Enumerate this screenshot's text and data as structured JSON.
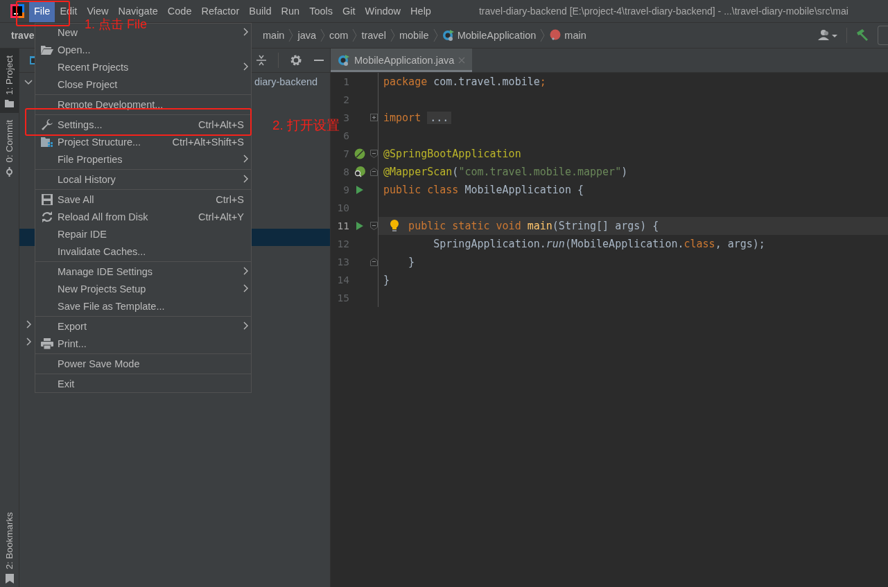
{
  "menu_bar": {
    "items": [
      {
        "label": "File",
        "selected": true
      },
      {
        "label": "Edit",
        "selected": false
      },
      {
        "label": "View",
        "selected": false
      },
      {
        "label": "Navigate",
        "selected": false
      },
      {
        "label": "Code",
        "selected": false
      },
      {
        "label": "Refactor",
        "selected": false
      },
      {
        "label": "Build",
        "selected": false
      },
      {
        "label": "Run",
        "selected": false
      },
      {
        "label": "Tools",
        "selected": false
      },
      {
        "label": "Git",
        "selected": false
      },
      {
        "label": "Window",
        "selected": false
      },
      {
        "label": "Help",
        "selected": false
      }
    ],
    "window_title": "travel-diary-backend [E:\\project-4\\travel-diary-backend] - ...\\travel-diary-mobile\\src\\mai"
  },
  "navigation_bar": {
    "project": "trave",
    "breadcrumbs": [
      {
        "label": "main",
        "kind": "folder"
      },
      {
        "label": "java",
        "kind": "folder"
      },
      {
        "label": "com",
        "kind": "folder"
      },
      {
        "label": "travel",
        "kind": "folder"
      },
      {
        "label": "mobile",
        "kind": "folder"
      },
      {
        "label": "MobileApplication",
        "kind": "class"
      },
      {
        "label": "main",
        "kind": "method"
      }
    ]
  },
  "tool_stripe": [
    {
      "label": "1: Project",
      "selected": true
    },
    {
      "label": "0: Commit",
      "selected": false
    }
  ],
  "bottom_stripe": [
    {
      "label": "2: Bookmarks",
      "selected": false
    }
  ],
  "project_panel": {
    "tree": [
      {
        "label": "diary-backend",
        "expanded": true,
        "selected": false
      },
      {
        "selected": true
      },
      {
        "expanded": false,
        "selected": false
      },
      {
        "expanded": false,
        "selected": false
      }
    ]
  },
  "file_menu": [
    {
      "kind": "item",
      "label": "New",
      "submenu": true
    },
    {
      "kind": "item",
      "label": "Open...",
      "submenu": false
    },
    {
      "kind": "item",
      "label": "Recent Projects",
      "submenu": true
    },
    {
      "kind": "item",
      "label": "Close Project",
      "submenu": false
    },
    {
      "kind": "separator"
    },
    {
      "kind": "item",
      "label": "Remote Development...",
      "submenu": false
    },
    {
      "kind": "separator"
    },
    {
      "kind": "item",
      "label": "Settings...",
      "shortcut": "Ctrl+Alt+S",
      "submenu": false
    },
    {
      "kind": "item",
      "label": "Project Structure...",
      "shortcut": "Ctrl+Alt+Shift+S",
      "submenu": false
    },
    {
      "kind": "item",
      "label": "File Properties",
      "submenu": true
    },
    {
      "kind": "separator"
    },
    {
      "kind": "item",
      "label": "Local History",
      "submenu": true
    },
    {
      "kind": "separator"
    },
    {
      "kind": "item",
      "label": "Save All",
      "shortcut": "Ctrl+S",
      "submenu": false
    },
    {
      "kind": "item",
      "label": "Reload All from Disk",
      "shortcut": "Ctrl+Alt+Y",
      "submenu": false
    },
    {
      "kind": "item",
      "label": "Repair IDE",
      "submenu": false
    },
    {
      "kind": "item",
      "label": "Invalidate Caches...",
      "submenu": false
    },
    {
      "kind": "separator"
    },
    {
      "kind": "item",
      "label": "Manage IDE Settings",
      "submenu": true
    },
    {
      "kind": "item",
      "label": "New Projects Setup",
      "submenu": true
    },
    {
      "kind": "item",
      "label": "Save File as Template...",
      "submenu": false
    },
    {
      "kind": "separator"
    },
    {
      "kind": "item",
      "label": "Export",
      "submenu": true
    },
    {
      "kind": "item",
      "label": "Print...",
      "submenu": false
    },
    {
      "kind": "separator"
    },
    {
      "kind": "item",
      "label": "Power Save Mode",
      "submenu": false
    },
    {
      "kind": "separator"
    },
    {
      "kind": "item",
      "label": "Exit",
      "submenu": false
    }
  ],
  "editor": {
    "tabs": [
      {
        "label": "MobileApplication.java",
        "selected": true
      }
    ],
    "lines": [
      {
        "number": "1",
        "tokens": [
          {
            "text": "package",
            "kind": "keyword"
          },
          {
            "text": " com.travel.mobile",
            "kind": "plain"
          },
          {
            "text": ";",
            "kind": "keyword"
          }
        ]
      },
      {
        "number": "2"
      },
      {
        "number": "3",
        "fold": {
          "kind": "collapsed"
        },
        "tokens": [
          {
            "text": "import ",
            "kind": "keyword"
          },
          {
            "text": "...",
            "kind": "folded"
          }
        ]
      },
      {
        "number": "6"
      },
      {
        "number": "7",
        "gutter": {
          "kind": "spring"
        },
        "fold": {
          "kind": "open"
        },
        "tokens": [
          {
            "text": "@SpringBootApplication",
            "kind": "annotation"
          }
        ]
      },
      {
        "number": "8",
        "gutter": {
          "kind": "spring-search"
        },
        "fold": {
          "kind": "close"
        },
        "tokens": [
          {
            "text": "@MapperScan",
            "kind": "annotation"
          },
          {
            "text": "(",
            "kind": "plain"
          },
          {
            "text": "\"com.travel.mobile.mapper\"",
            "kind": "string"
          },
          {
            "text": ")",
            "kind": "plain"
          }
        ]
      },
      {
        "number": "9",
        "gutter": {
          "kind": "run"
        },
        "tokens": [
          {
            "text": "public class",
            "kind": "keyword"
          },
          {
            "text": " MobileApplication {",
            "kind": "plain"
          }
        ]
      },
      {
        "number": "10"
      },
      {
        "number": "11",
        "gutter": {
          "kind": "run"
        },
        "fold": {
          "kind": "open"
        },
        "current": true,
        "intention": true,
        "tokens": [
          {
            "text": "    public static void",
            "kind": "keyword"
          },
          {
            "text": " main",
            "kind": "method"
          },
          {
            "text": "(String[] args) {",
            "kind": "plain"
          }
        ]
      },
      {
        "number": "12",
        "tokens": [
          {
            "text": "        SpringApplication.",
            "kind": "plain"
          },
          {
            "text": "run",
            "kind": "italic"
          },
          {
            "text": "(MobileApplication.",
            "kind": "plain"
          },
          {
            "text": "class",
            "kind": "keyword"
          },
          {
            "text": ", args);",
            "kind": "plain"
          }
        ]
      },
      {
        "number": "13",
        "fold": {
          "kind": "close"
        },
        "tokens": [
          {
            "text": "    }",
            "kind": "plain"
          }
        ]
      },
      {
        "number": "14",
        "tokens": [
          {
            "text": "}",
            "kind": "plain"
          }
        ]
      },
      {
        "number": "15"
      }
    ]
  },
  "annotations": [
    {
      "text": "1. 点击 File"
    },
    {
      "text": "2. 打开设置"
    }
  ]
}
